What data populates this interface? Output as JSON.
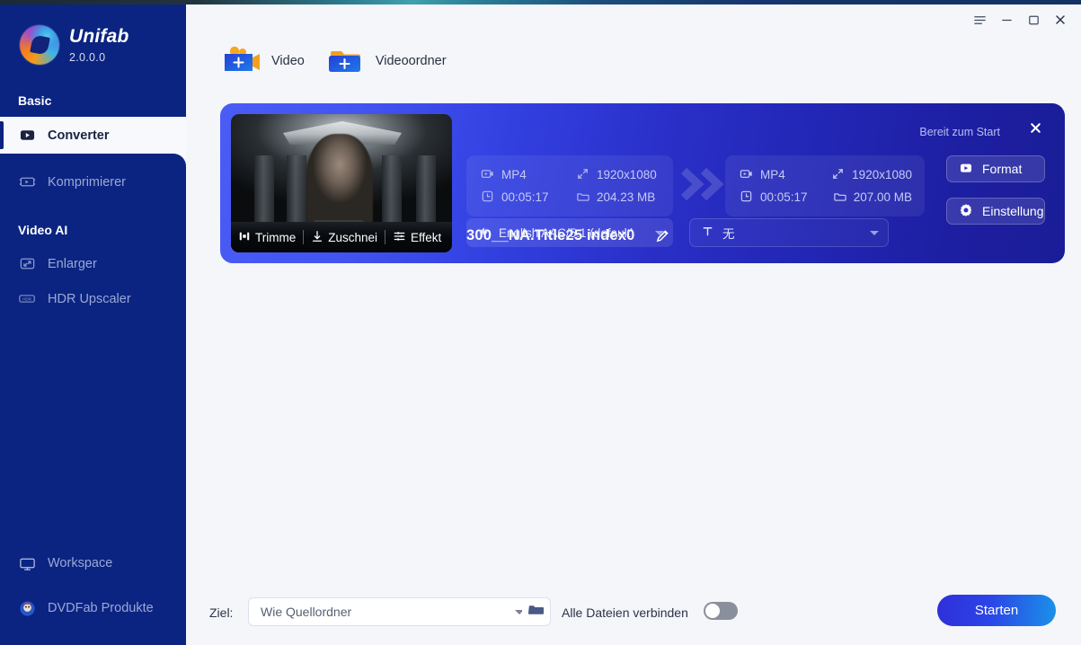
{
  "window": {
    "controls": [
      {
        "name": "menu-button",
        "icon": "hamburger-icon",
        "label": "Menü"
      },
      {
        "name": "minimize-button",
        "icon": "minimize-icon",
        "label": "Minimieren"
      },
      {
        "name": "maximize-button",
        "icon": "maximize-icon",
        "label": "Maximieren"
      },
      {
        "name": "close-button",
        "icon": "close-icon",
        "label": "Schließen"
      }
    ]
  },
  "sidebar": {
    "app_name": "Unifab",
    "version": "2.0.0.0",
    "sections": [
      {
        "title": "Basic"
      },
      {
        "title": "Video AI"
      }
    ],
    "items": [
      {
        "label": "Converter",
        "icon": "converter-icon",
        "active": true
      },
      {
        "label": "Komprimierer",
        "icon": "compress-icon",
        "active": false
      },
      {
        "label": "Enlarger",
        "icon": "enlarge-icon",
        "active": false
      },
      {
        "label": "HDR Upscaler",
        "icon": "hdr-icon",
        "active": false
      }
    ],
    "bottom_items": [
      {
        "label": "Workspace",
        "icon": "monitor-icon"
      },
      {
        "label": "DVDFab Produkte",
        "icon": "dvdfab-icon"
      }
    ]
  },
  "toolbar": {
    "add_video_label": "Video",
    "add_folder_label": "Videoordner"
  },
  "job": {
    "title": "300__NA.Title25 index0",
    "status": "Bereit zum Start",
    "source": {
      "format": "MP4",
      "resolution": "1920x1080",
      "duration": "00:05:17",
      "size": "204.23 MB"
    },
    "target": {
      "format": "MP4",
      "resolution": "1920x1080",
      "duration": "00:05:17",
      "size": "207.00 MB"
    },
    "audio_track": "English AAC/5.1 (default)",
    "subtitle_track": "无",
    "thumb_tools": [
      {
        "label": "Trimme",
        "icon": "trim-icon"
      },
      {
        "label": "Zuschnei",
        "icon": "crop-icon"
      },
      {
        "label": "Effekt",
        "icon": "effect-icon"
      }
    ],
    "buttons": {
      "format": "Format",
      "settings": "Einstellunge"
    }
  },
  "bottom": {
    "destination_label": "Ziel:",
    "destination_value": "Wie Quellordner",
    "merge_label": "Alle Dateien verbinden",
    "merge_on": false,
    "start_label": "Starten"
  },
  "colors": {
    "sidebar_bg": "#0b2481",
    "card_start": "#4a5cf5",
    "card_end": "#1a1d96",
    "accent": "#2b45e8",
    "page_bg": "#f4f6fa"
  }
}
